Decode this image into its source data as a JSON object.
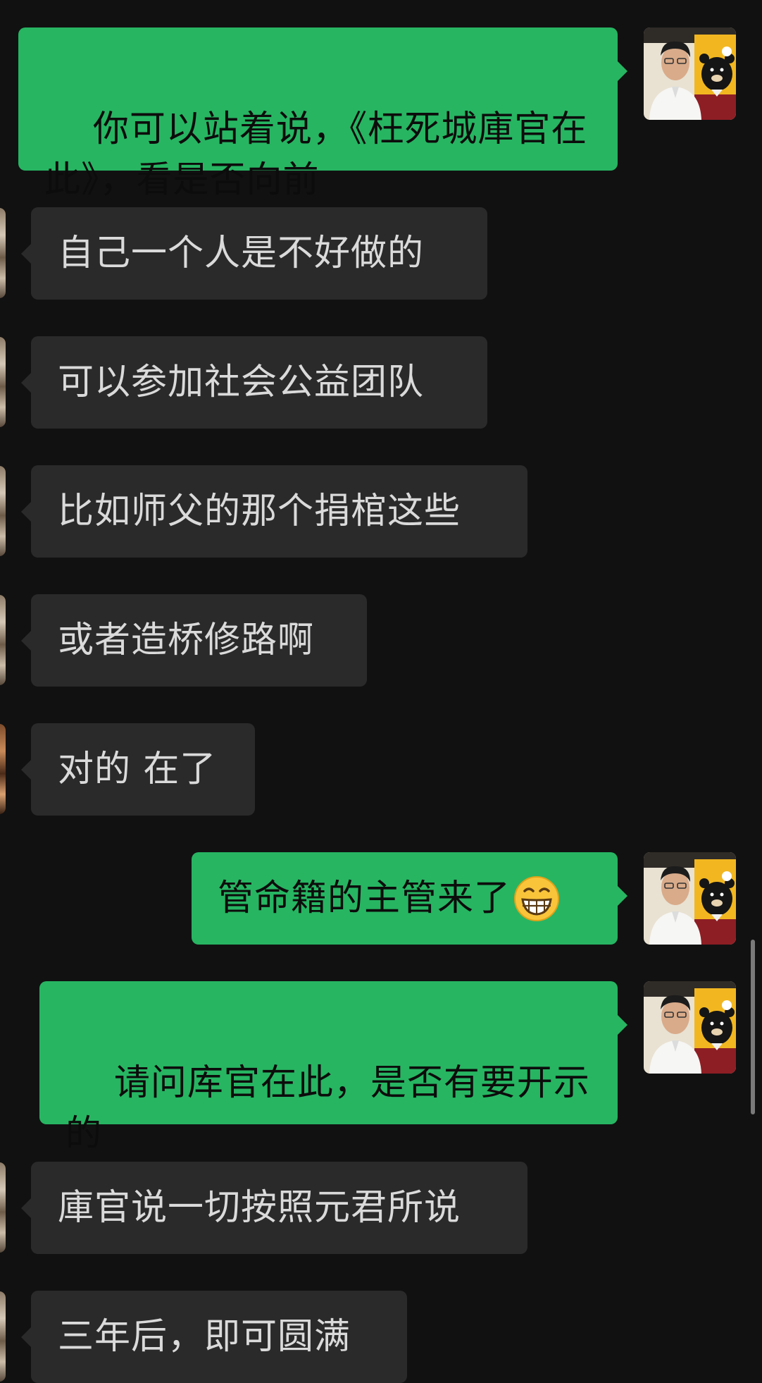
{
  "conversation": {
    "messages": [
      {
        "side": "out",
        "text": "你可以站着说，《枉死城庫官在此》，看是否向前"
      },
      {
        "side": "in",
        "text": "自己一个人是不好做的"
      },
      {
        "side": "in",
        "text": "可以参加社会公益团队"
      },
      {
        "side": "in",
        "text": "比如师父的那个捐棺这些"
      },
      {
        "side": "in",
        "text": "或者造桥修路啊"
      },
      {
        "side": "in",
        "text": "对的 在了"
      },
      {
        "side": "out",
        "text": "管命籍的主管来了"
      },
      {
        "side": "out",
        "text": "请问库官在此，是否有要开示的"
      },
      {
        "side": "in",
        "text": "庫官说一切按照元君所说"
      },
      {
        "side": "in",
        "text": "三年后，即可圆满"
      }
    ]
  },
  "icons": {
    "emoji": "grinning-face-icon",
    "self_avatar": "user-photo-with-bear-mascot",
    "peer_avatar": "peer-photo"
  },
  "colors": {
    "background": "#111111",
    "outgoing_bubble": "#27b562",
    "incoming_bubble": "#2a2a2a",
    "incoming_text": "#dadada",
    "outgoing_text": "#0c0c0c"
  }
}
